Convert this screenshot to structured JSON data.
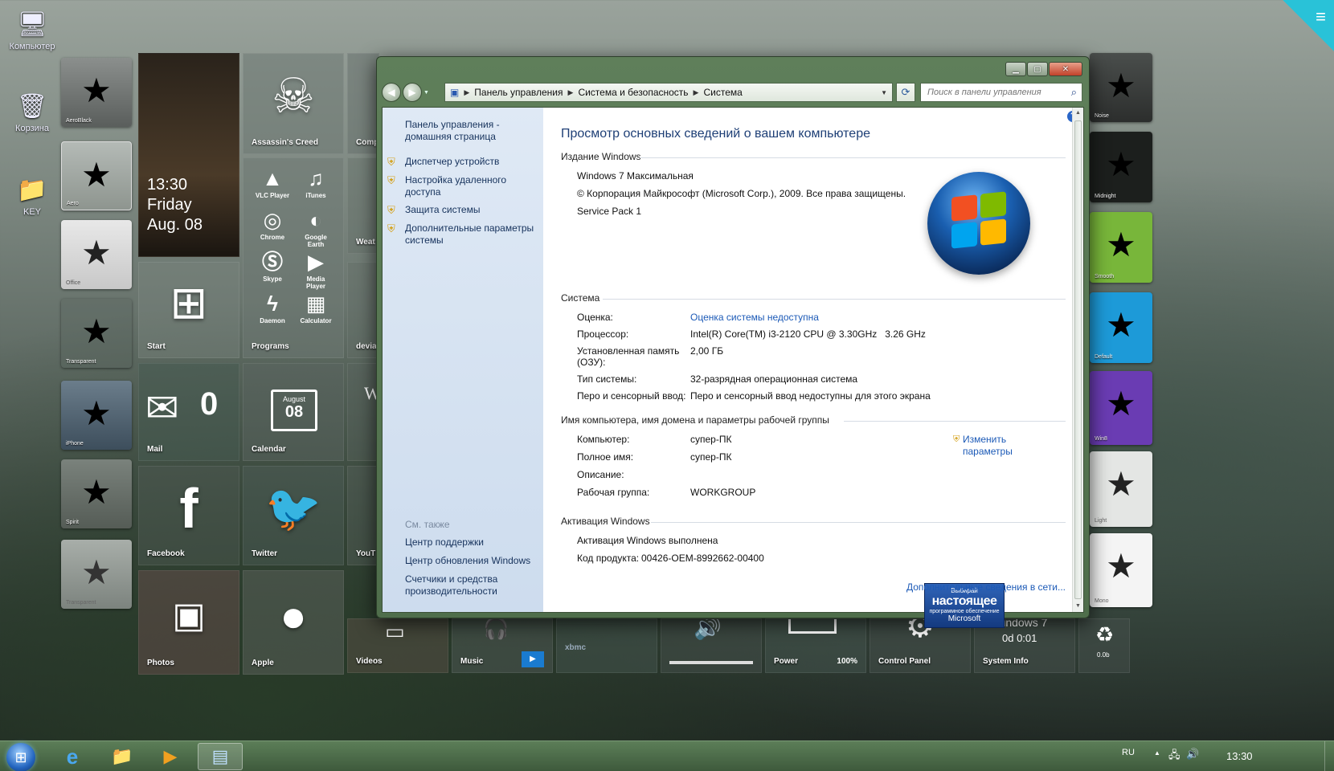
{
  "desktop": {
    "icons": [
      {
        "label": "Компьютер",
        "icon": "computer-icon"
      },
      {
        "label": "Корзина",
        "icon": "recycle-bin-icon"
      },
      {
        "label": "KEY",
        "icon": "key-folder-icon"
      }
    ]
  },
  "themes_left": [
    {
      "label": "AeroBlack"
    },
    {
      "label": "Aero"
    },
    {
      "label": "Office"
    },
    {
      "label": "Transparent"
    },
    {
      "label": "iPhone"
    },
    {
      "label": "Spirit"
    },
    {
      "label": "Transparent"
    }
  ],
  "themes_right": [
    {
      "label": "Noise"
    },
    {
      "label": "Midnight"
    },
    {
      "label": "Smooth"
    },
    {
      "label": "Default"
    },
    {
      "label": "Win8"
    },
    {
      "label": "Light"
    },
    {
      "label": "Mono"
    }
  ],
  "tiles": {
    "clock": {
      "time": "13:30",
      "day": "Friday",
      "date": "Aug. 08"
    },
    "assassins": {
      "label": "Assassin's Creed"
    },
    "programs": {
      "label": "Programs",
      "items": [
        {
          "label": "VLC Player",
          "icon": "vlc-icon"
        },
        {
          "label": "iTunes",
          "icon": "itunes-icon"
        },
        {
          "label": "Chrome",
          "icon": "chrome-icon"
        },
        {
          "label": "Google Earth",
          "icon": "google-earth-icon"
        },
        {
          "label": "Skype",
          "icon": "skype-icon"
        },
        {
          "label": "Media Player",
          "icon": "media-player-icon"
        },
        {
          "label": "Daemon",
          "icon": "daemon-icon"
        },
        {
          "label": "Calculator",
          "icon": "calculator-icon"
        }
      ]
    },
    "start": {
      "label": "Start"
    },
    "mail": {
      "label": "Mail",
      "count": "0"
    },
    "calendar": {
      "label": "Calendar",
      "month": "August",
      "day": "08"
    },
    "facebook": {
      "label": "Facebook"
    },
    "twitter": {
      "label": "Twitter"
    },
    "photos": {
      "label": "Photos"
    },
    "apple": {
      "label": "Apple"
    },
    "videos": {
      "label": "Videos"
    },
    "music": {
      "label": "Music"
    },
    "power": {
      "label": "Power",
      "percent": "100%"
    },
    "control_panel": {
      "label": "Control Panel"
    },
    "sysinfo": {
      "label": "System Info",
      "title": "Windows 7",
      "uptime": "0d 0:01"
    },
    "recycle": {
      "value": "0.0b"
    },
    "partial": {
      "comp": "Comp",
      "weather": "Weat",
      "devices": "devia",
      "youtube": "YouT"
    }
  },
  "window": {
    "breadcrumbs": [
      "Панель управления",
      "Система и безопасность",
      "Система"
    ],
    "search_placeholder": "Поиск в панели управления",
    "left_pane": {
      "home": "Панель управления - домашняя страница",
      "links": [
        "Диспетчер устройств",
        "Настройка удаленного доступа",
        "Защита системы",
        "Дополнительные параметры системы"
      ],
      "see_also_title": "См. также",
      "see_also": [
        "Центр поддержки",
        "Центр обновления Windows",
        "Счетчики и средства производительности"
      ]
    },
    "content": {
      "title": "Просмотр основных сведений о вашем компьютере",
      "edition": {
        "header": "Издание Windows",
        "name": "Windows 7 Максимальная",
        "copyright": "© Корпорация Майкрософт (Microsoft Corp.), 2009. Все права защищены.",
        "sp": "Service Pack 1"
      },
      "system": {
        "header": "Система",
        "rows": [
          {
            "label": "Оценка:",
            "value": "Оценка системы недоступна"
          },
          {
            "label": "Процессор:",
            "value": "Intel(R) Core(TM) i3-2120 CPU @ 3.30GHz   3.26 GHz"
          },
          {
            "label": "Установленная память (ОЗУ):",
            "value": "2,00 ГБ"
          },
          {
            "label": "Тип системы:",
            "value": "32-разрядная операционная система"
          },
          {
            "label": "Перо и сенсорный ввод:",
            "value": "Перо и сенсорный ввод недоступны для этого экрана"
          }
        ]
      },
      "computer_name": {
        "header": "Имя компьютера, имя домена и параметры рабочей группы",
        "change": "Изменить параметры",
        "rows": [
          {
            "label": "Компьютер:",
            "value": "супер-ПК"
          },
          {
            "label": "Полное имя:",
            "value": "супер-ПК"
          },
          {
            "label": "Описание:",
            "value": ""
          },
          {
            "label": "Рабочая группа:",
            "value": "WORKGROUP"
          }
        ]
      },
      "activation": {
        "header": "Активация Windows",
        "status": "Активация Windows выполнена",
        "product_key_label": "Код продукта:",
        "product_key": "00426-OEM-8992662-00400",
        "more": "Дополнительные сведения в сети...",
        "genuine": {
          "line1": "Выбирай",
          "line2": "настоящее",
          "line3": "программное обеспечение",
          "line4": "Microsoft"
        }
      }
    }
  },
  "taskbar": {
    "apps": [
      "internet-explorer-icon",
      "explorer-icon",
      "media-player-icon",
      "control-panel-icon"
    ],
    "lang": "RU",
    "time": "13:30"
  },
  "colors": {
    "accent": "#1e3f76",
    "link": "#1c5ab7",
    "taskbar": "#4b6a48"
  }
}
